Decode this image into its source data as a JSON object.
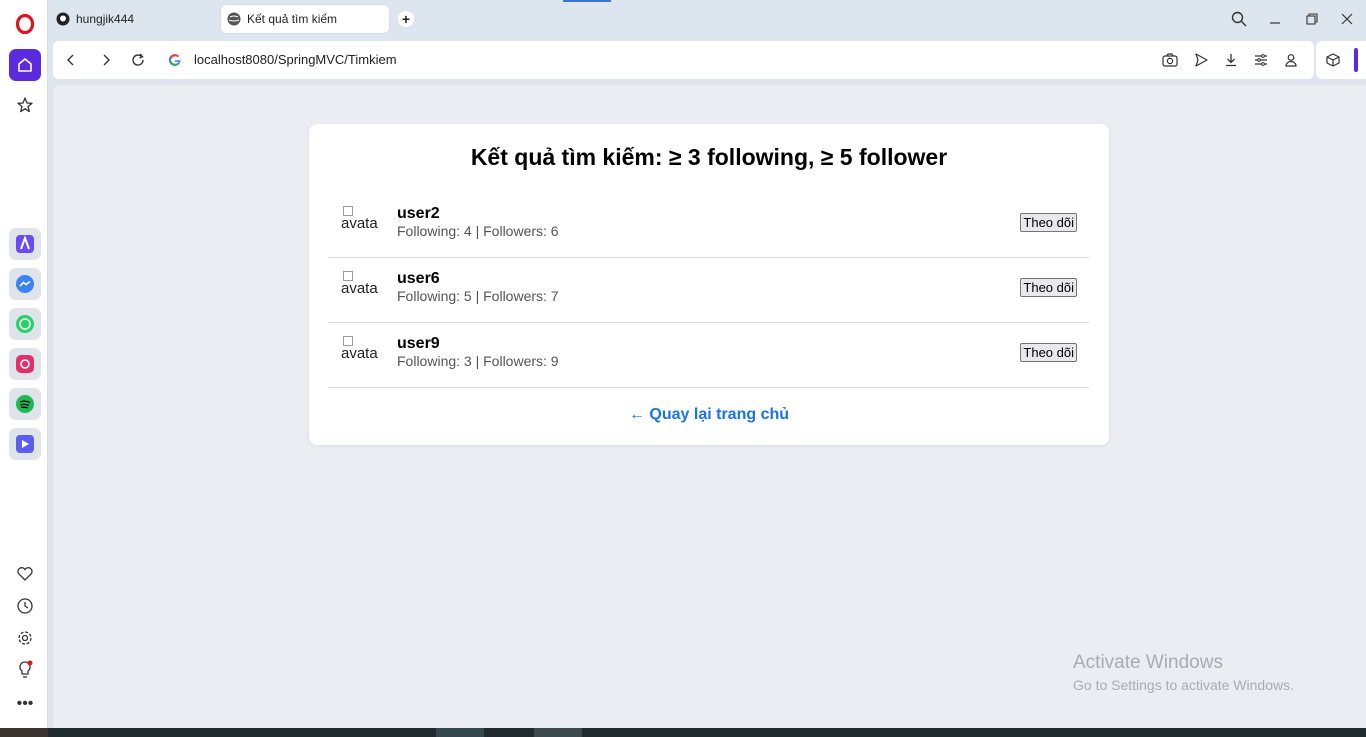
{
  "browser": {
    "tabs": [
      {
        "label": "hungjik444",
        "icon": "github-icon"
      },
      {
        "label": "Kết quả tìm kiếm",
        "icon": "globe-icon"
      }
    ],
    "url": "localhost8080/SpringMVC/Timkiem"
  },
  "page": {
    "title": "Kết quả tìm kiếm: ≥ 3 following, ≥ 5 follower",
    "users": [
      {
        "avatar_alt": "avata",
        "name": "user2",
        "stats": "Following: 4 | Followers: 6",
        "button": "Theo dõi"
      },
      {
        "avatar_alt": "avata",
        "name": "user6",
        "stats": "Following: 5 | Followers: 7",
        "button": "Theo dõi"
      },
      {
        "avatar_alt": "avata",
        "name": "user9",
        "stats": "Following: 3 | Followers: 9",
        "button": "Theo dõi"
      }
    ],
    "back_link": "← Quay lại trang chủ"
  },
  "watermark": {
    "line1": "Activate Windows",
    "line2": "Go to Settings to activate Windows."
  },
  "colors": {
    "accent": "#1a73e8",
    "opera_red": "#e1141e",
    "sidebar_active": "#5b2be0"
  }
}
